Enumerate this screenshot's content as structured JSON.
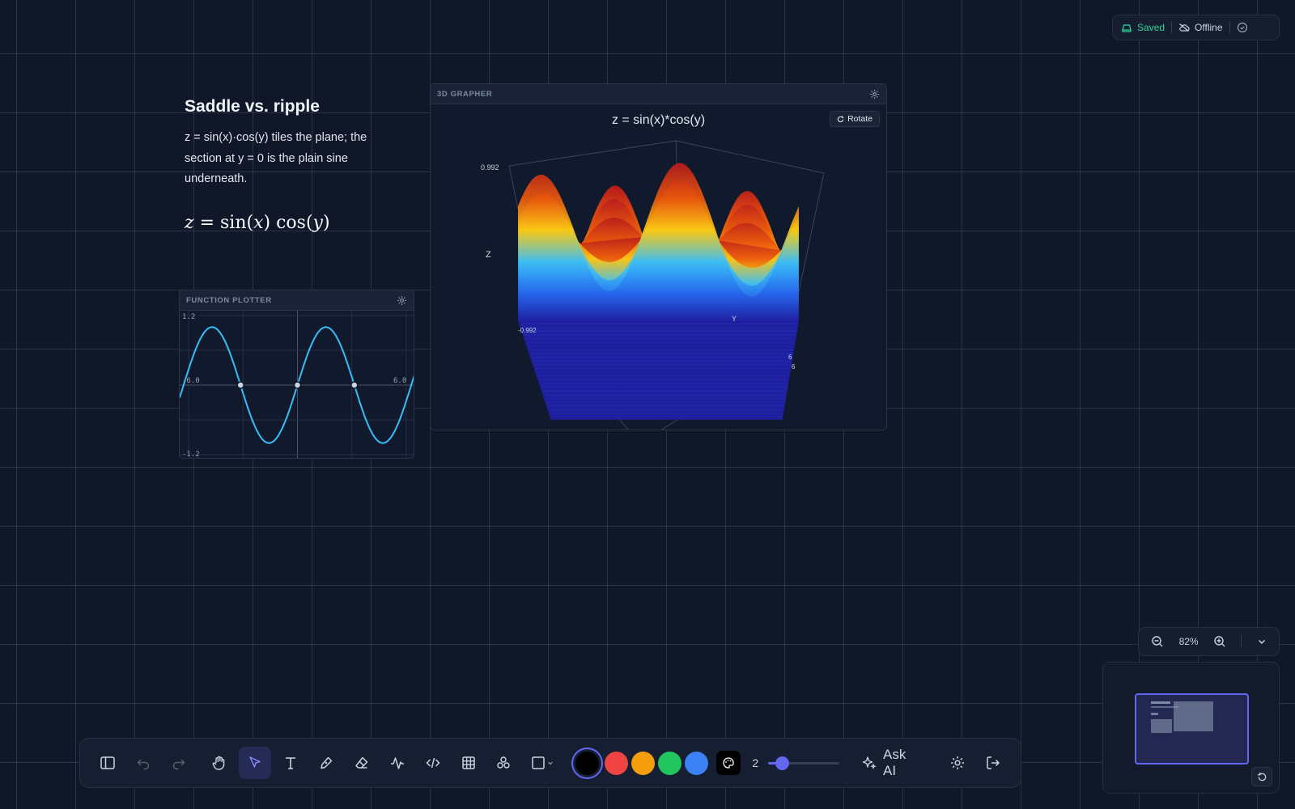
{
  "status": {
    "saved": "Saved",
    "offline": "Offline"
  },
  "note": {
    "title": "Saddle vs. ripple",
    "body": "z = sin(x)·cos(y) tiles the plane; the section at y = 0 is the plain sine underneath.",
    "formula": "z = sin(x) cos(y)"
  },
  "plotter": {
    "header": "FUNCTION PLOTTER",
    "y_max_label": "1.2",
    "y_min_label": "-1.2",
    "x_min_label": "-6.0",
    "x_max_label": "6.0"
  },
  "grapher": {
    "header": "3D GRAPHER",
    "title": "z = sin(x)*cos(y)",
    "rotate_label": "Rotate",
    "z_max": "0.992",
    "z_min": "-0.992",
    "z_axis": "Z",
    "y_axis": "Y",
    "tick_a": "6",
    "tick_b": "6"
  },
  "zoom": {
    "level": "82%"
  },
  "toolbar": {
    "tools": [
      "sidebar-toggle",
      "undo",
      "redo",
      "hand",
      "select",
      "text",
      "pen",
      "eraser",
      "function",
      "code",
      "table",
      "nodes",
      "shape"
    ],
    "active_tool": "select",
    "colors": [
      "#000000",
      "#ef4444",
      "#f59e0b",
      "#22c55e",
      "#3b82f6"
    ],
    "selected_color": "#000000",
    "stroke_size": "2",
    "stroke_slider_fraction": 0.12,
    "ask_ai": "Ask AI"
  },
  "chart_data": [
    {
      "type": "line",
      "xlim": [
        -6.0,
        6.0
      ],
      "ylim": [
        -1.2,
        1.2
      ],
      "series": [
        {
          "x": [
            -6.5,
            -6,
            -5.5,
            -5,
            -4.5,
            -4,
            -3.5,
            -3,
            -2.5,
            -2,
            -1.5,
            -1,
            -0.5,
            0,
            0.5,
            1,
            1.5,
            2,
            2.5,
            3,
            3.5,
            4,
            4.5,
            5,
            5.5,
            6,
            6.5
          ],
          "y": [
            -0.215,
            0.279,
            0.706,
            0.959,
            0.978,
            0.757,
            0.351,
            -0.141,
            -0.598,
            -0.909,
            -0.997,
            -0.841,
            -0.479,
            0,
            0.479,
            0.841,
            0.997,
            0.909,
            0.598,
            0.141,
            -0.351,
            -0.757,
            -0.978,
            -0.959,
            -0.706,
            -0.279,
            0.215
          ]
        }
      ],
      "markers_x": [
        -3.14,
        0,
        3.14
      ]
    },
    {
      "type": "surface",
      "title": "z = sin(x)*cos(y)",
      "zlim": [
        -0.992,
        0.992
      ],
      "colorscale": [
        "#1e1b9b",
        "#38bdf8",
        "#facc15",
        "#ea580c",
        "#b91c1c"
      ]
    }
  ]
}
